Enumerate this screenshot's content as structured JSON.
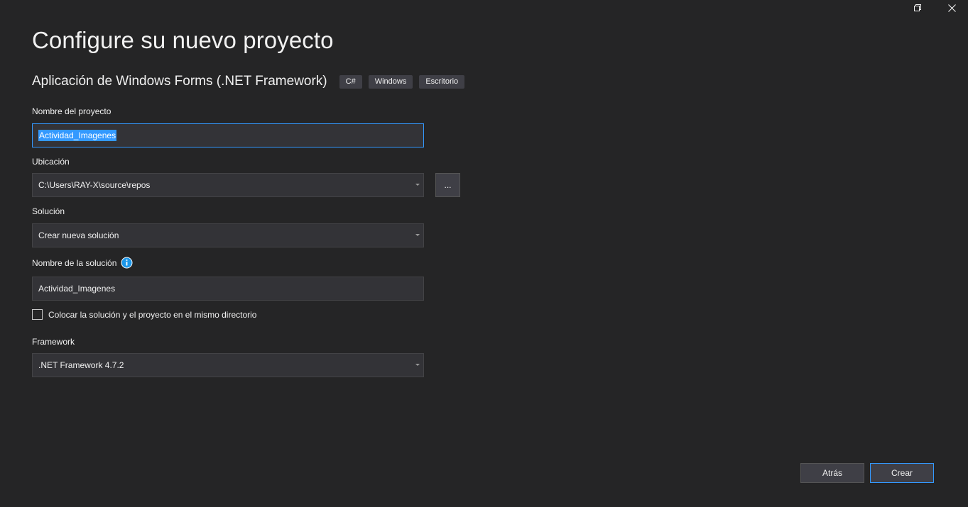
{
  "window": {
    "restore_icon": "restore-icon",
    "close_icon": "close-icon"
  },
  "header": {
    "title": "Configure su nuevo proyecto",
    "template_name": "Aplicación de Windows Forms (.NET Framework)",
    "tags": [
      "C#",
      "Windows",
      "Escritorio"
    ]
  },
  "form": {
    "project_name": {
      "label": "Nombre del proyecto",
      "value": "Actividad_Imagenes"
    },
    "location": {
      "label": "Ubicación",
      "value": "C:\\Users\\RAY-X\\source\\repos",
      "browse_label": "..."
    },
    "solution": {
      "label": "Solución",
      "value": "Crear nueva solución"
    },
    "solution_name": {
      "label": "Nombre de la solución",
      "value": "Actividad_Imagenes",
      "info_icon": "info-icon"
    },
    "same_directory": {
      "label": "Colocar la solución y el proyecto en el mismo directorio",
      "checked": false
    },
    "framework": {
      "label": "Framework",
      "value": ".NET Framework 4.7.2"
    }
  },
  "footer": {
    "back_label": "Atrás",
    "create_label": "Crear"
  },
  "colors": {
    "background": "#252526",
    "input_background": "#333337",
    "accent": "#3399ff",
    "button_background": "#3f3f46",
    "info_icon": "#1c97ea"
  }
}
